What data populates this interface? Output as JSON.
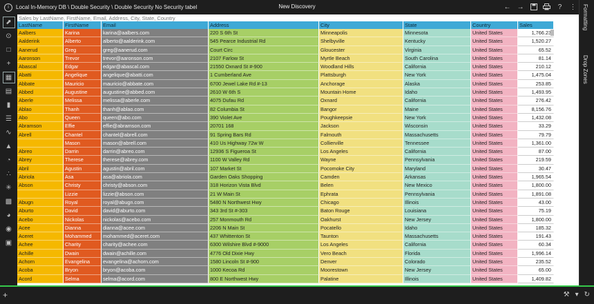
{
  "titlebar": {
    "breadcrumb": "Local In-Memory DB \\ Double Security \\ Double Security No Security tabel",
    "window_title": "New Discovery"
  },
  "search": {
    "placeholder": "Sales by LastName, FirstName, Email, Address, City, State, Country"
  },
  "right_panel": {
    "formatting_label": "Formatting",
    "drop_zones_label": "Drop Zones"
  },
  "table": {
    "columns": [
      "LastName",
      "FirstName",
      "Email",
      "Address",
      "City",
      "State",
      "Country",
      "Sales"
    ],
    "rows": [
      [
        "Aalbers",
        "Karina",
        "karina@aalbers.com",
        "220 S 6th St",
        "Minneapolis",
        "Minnesota",
        "United States",
        "1,766.23"
      ],
      [
        "Aalderink",
        "Alberto",
        "alberto@aalderink.com",
        "545 Pearce Industrial Rd",
        "Shelbyville",
        "Kentucky",
        "United States",
        "1,520.27"
      ],
      [
        "Aanerud",
        "Greg",
        "greg@aanerud.com",
        "Court Circ",
        "Gloucester",
        "Virginia",
        "United States",
        "65.52"
      ],
      [
        "Aaronson",
        "Trevor",
        "trevor@aaronson.com",
        "2107 Farlow St",
        "Myrtle Beach",
        "South Carolina",
        "United States",
        "81.14"
      ],
      [
        "Abascal",
        "Edgar",
        "edgar@abascal.com",
        "21550 Oxnard St #-900",
        "Woodland Hills",
        "California",
        "United States",
        "210.12"
      ],
      [
        "Abatti",
        "Angelique",
        "angelique@abatti.com",
        "1 Cumberland Ave",
        "Plattsburgh",
        "New York",
        "United States",
        "1,475.04"
      ],
      [
        "Abbate",
        "Mauricio",
        "mauricio@abbate.com",
        "6700 Jewel Lake Rd #-13",
        "Anchorage",
        "Alaska",
        "United States",
        "253.85"
      ],
      [
        "Abbed",
        "Augustine",
        "augustine@abbed.com",
        "2610 W 6th S",
        "Mountain Home",
        "Idaho",
        "United States",
        "1,493.95"
      ],
      [
        "Aberle",
        "Melissa",
        "melissa@aberle.com",
        "4075 Dufau Rd",
        "Oxnard",
        "California",
        "United States",
        "276.42"
      ],
      [
        "Ablao",
        "Thanh",
        "thanh@ablao.com",
        "82 Columbia St",
        "Bangor",
        "Maine",
        "United States",
        "8,156.76"
      ],
      [
        "Abo",
        "Queen",
        "queen@abo.com",
        "390 Violet Ave",
        "Poughkeepsie",
        "New York",
        "United States",
        "1,432.08"
      ],
      [
        "Abramson",
        "Effie",
        "effie@abramson.com",
        "20701 168",
        "Jackson",
        "Wisconsin",
        "United States",
        "33.29"
      ],
      [
        "Abrell",
        "Chantel",
        "chantel@abrell.com",
        "91 Spring Bars Rd",
        "Falmouth",
        "Massachusetts",
        "United States",
        "79.79"
      ],
      [
        "",
        "Mason",
        "mason@abrell.com",
        "410 Us Highway 72w W",
        "Collierville",
        "Tennessee",
        "United States",
        "1,361.00"
      ],
      [
        "Abreo",
        "Darrin",
        "darrin@abreo.com",
        "12936 S Figueroa St",
        "Los Angeles",
        "California",
        "United States",
        "87.00"
      ],
      [
        "Abrey",
        "Therese",
        "therese@abrey.com",
        "1100 W Valley Rd",
        "Wayne",
        "Pennsylvania",
        "United States",
        "219.59"
      ],
      [
        "Abril",
        "Agustin",
        "agustin@abril.com",
        "107 Market St",
        "Pocomoke City",
        "Maryland",
        "United States",
        "30.47"
      ],
      [
        "Abriola",
        "Asa",
        "asa@abriola.com",
        "Garden Oaks Shopping",
        "Camden",
        "Arkansas",
        "United States",
        "1,965.54"
      ],
      [
        "Abson",
        "Christy",
        "christy@abson.com",
        "318 Horizon Vista Blvd",
        "Belen",
        "New Mexico",
        "United States",
        "1,800.00"
      ],
      [
        "",
        "Lizzie",
        "lizzie@abson.com",
        "21 W Main St",
        "Ephrata",
        "Pennsylvania",
        "United States",
        "1,891.08"
      ],
      [
        "Abugn",
        "Royal",
        "royal@abugn.com",
        "5480 N Northwest Hwy",
        "Chicago",
        "Illinois",
        "United States",
        "43.00"
      ],
      [
        "Aburto",
        "David",
        "david@aburto.com",
        "343 3rd St #-303",
        "Baton Rouge",
        "Louisiana",
        "United States",
        "75.19"
      ],
      [
        "Acebo",
        "Nickolas",
        "nickolas@acebo.com",
        "257 Monmouth Rd",
        "Oakhurst",
        "New Jersey",
        "United States",
        "1,800.00"
      ],
      [
        "Acee",
        "Dianna",
        "dianna@acee.com",
        "2206 N Main St",
        "Pocatello",
        "Idaho",
        "United States",
        "185.32"
      ],
      [
        "Aceret",
        "Mohammed",
        "mohammed@aceret.com",
        "437 Whittenton St",
        "Taunton",
        "Massachusetts",
        "United States",
        "191.43"
      ],
      [
        "Achee",
        "Charity",
        "charity@achee.com",
        "6300 Wilshire Blvd #-9000",
        "Los Angeles",
        "California",
        "United States",
        "60.34"
      ],
      [
        "Achille",
        "Dwain",
        "dwain@achille.com",
        "4776 Old Dixie Hwy",
        "Vero Beach",
        "Florida",
        "United States",
        "1,996.14"
      ],
      [
        "Achorn",
        "Evangelina",
        "evangelina@achorn.com",
        "1580 Lincoln St #-900",
        "Denver",
        "Colorado",
        "United States",
        "235.52"
      ],
      [
        "Acoba",
        "Bryon",
        "bryon@acoba.com",
        "1000 Kecoa Rd",
        "Moorestown",
        "New Jersey",
        "United States",
        "65.00"
      ],
      [
        "Acord",
        "Selma",
        "selma@acord.com",
        "800 E Northwest Hwy",
        "Palatine",
        "Illinois",
        "United States",
        "1,409.82"
      ]
    ]
  },
  "colors": {
    "header": "#3fa9d6",
    "lastname": "#f5b800",
    "firstname": "#e05a20",
    "email": "#808080",
    "address": "#a7cf66",
    "city": "#f1e080",
    "state": "#a7dccb",
    "country": "#f2b3c2",
    "status_accent": "#35c94a"
  },
  "icons": {
    "left_toolbar": [
      "pointer-icon",
      "cross-filter-icon",
      "selection-icon",
      "add-icon",
      "table-icon",
      "bar-chart-icon",
      "column-chart-icon",
      "stacked-bar-icon",
      "line-chart-icon",
      "area-chart-icon",
      "pie-chart-icon",
      "scatter-icon",
      "network-icon",
      "heatmap-icon",
      "gauge-icon",
      "globe-icon",
      "custom-visual-icon"
    ]
  }
}
